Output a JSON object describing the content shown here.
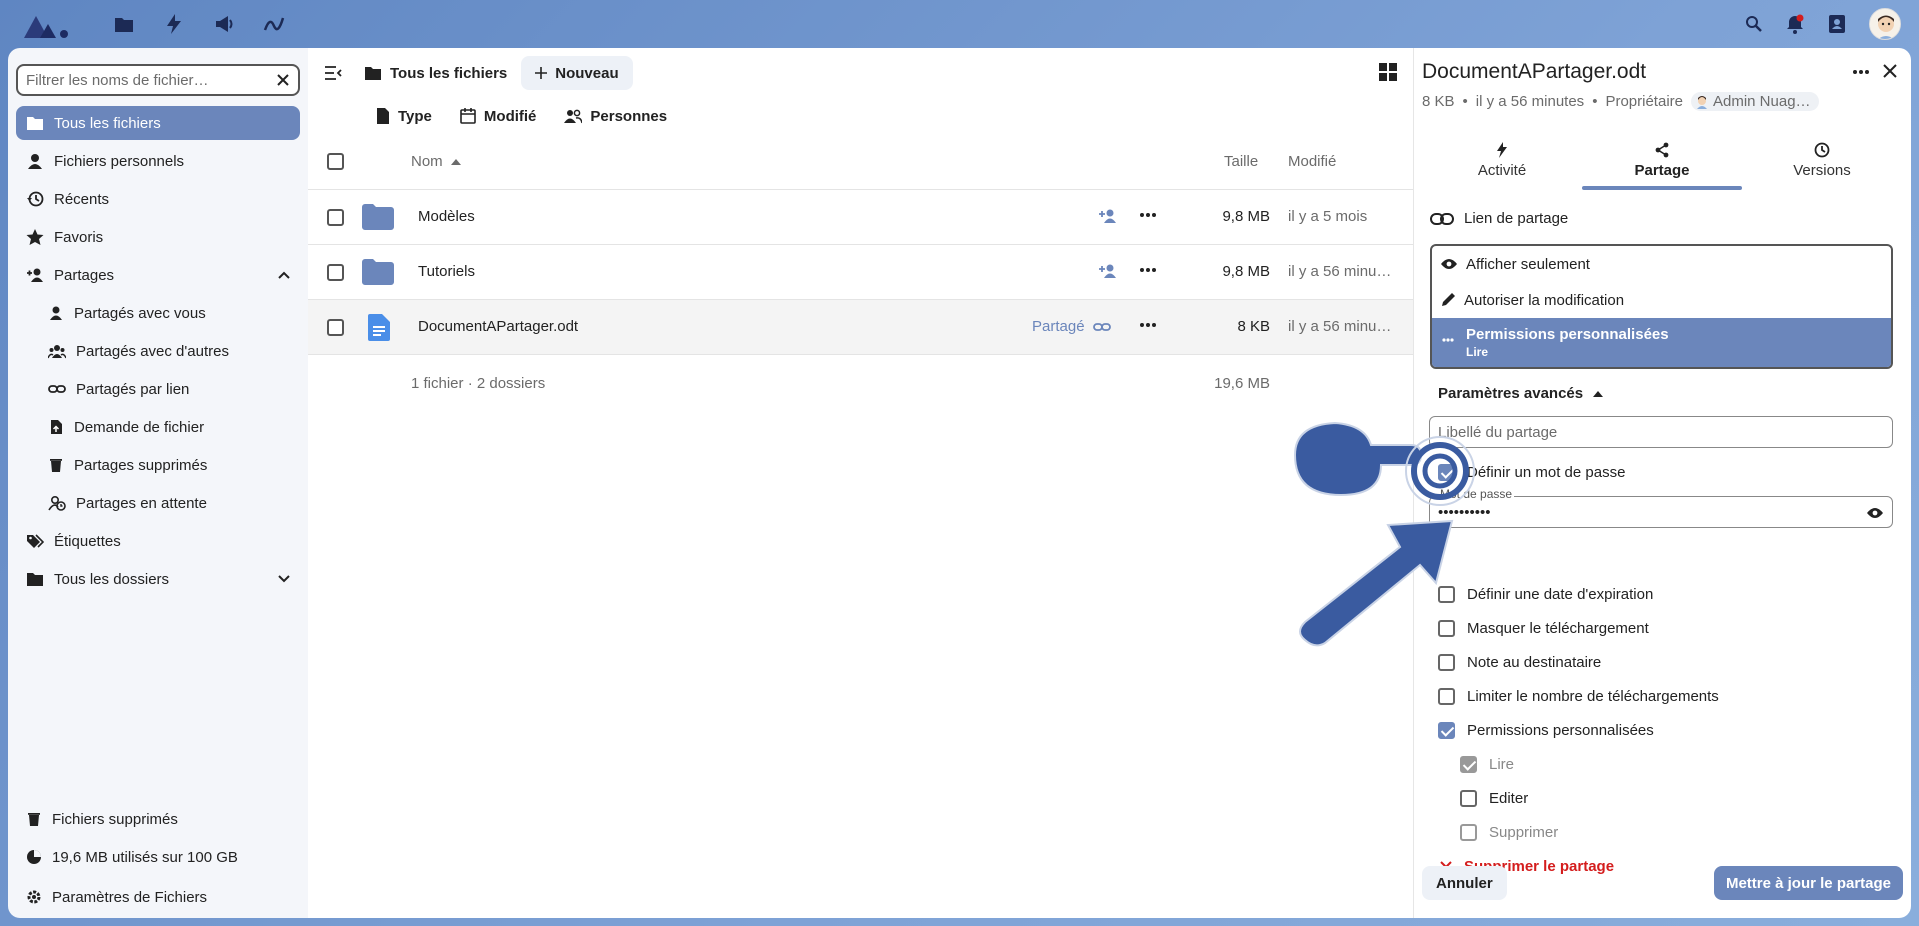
{
  "sidebar": {
    "filter_placeholder": "Filtrer les noms de fichier…",
    "items": [
      {
        "label": "Tous les fichiers"
      },
      {
        "label": "Fichiers personnels"
      },
      {
        "label": "Récents"
      },
      {
        "label": "Favoris"
      },
      {
        "label": "Partages"
      },
      {
        "label": "Partagés avec vous"
      },
      {
        "label": "Partagés avec d'autres"
      },
      {
        "label": "Partagés par lien"
      },
      {
        "label": "Demande de fichier"
      },
      {
        "label": "Partages supprimés"
      },
      {
        "label": "Partages en attente"
      },
      {
        "label": "Étiquettes"
      },
      {
        "label": "Tous les dossiers"
      }
    ],
    "deleted": "Fichiers supprimés",
    "quota": "19,6 MB utilisés sur 100 GB",
    "settings": "Paramètres de Fichiers"
  },
  "main": {
    "breadcrumb": "Tous les fichiers",
    "new_label": "Nouveau",
    "filters": [
      "Type",
      "Modifié",
      "Personnes"
    ],
    "columns": {
      "name": "Nom",
      "size": "Taille",
      "modified": "Modifié"
    },
    "rows": [
      {
        "name": "Modèles",
        "size": "9,8 MB",
        "modified": "il y a 5 mois"
      },
      {
        "name": "Tutoriels",
        "size": "9,8 MB",
        "modified": "il y a 56 minu…"
      },
      {
        "name": "DocumentAPartager.odt",
        "size": "8 KB",
        "modified": "il y a 56 minu…",
        "shared": "Partagé"
      }
    ],
    "summary": "1 fichier · 2 dossiers",
    "summary_size": "19,6 MB"
  },
  "panel": {
    "title": "DocumentAPartager.odt",
    "size": "8 KB",
    "time": "il y a 56 minutes",
    "role": "Propriétaire",
    "owner": "Admin Nuag…",
    "tabs": [
      "Activité",
      "Partage",
      "Versions"
    ],
    "link_label": "Lien de partage",
    "options": [
      "Afficher seulement",
      "Autoriser la modification"
    ],
    "selected_option": "Permissions personnalisées",
    "selected_sub": "Lire",
    "advanced": "Paramètres avancés",
    "label_placeholder": "Libellé du partage",
    "set_password": "Définir un mot de passe",
    "password_label": "Mot de passe",
    "password_value": "••••••••••",
    "checks": [
      "Définir une date d'expiration",
      "Masquer le téléchargement",
      "Note au destinataire",
      "Limiter le nombre de téléchargements",
      "Permissions personnalisées"
    ],
    "perms": [
      "Lire",
      "Editer",
      "Supprimer"
    ],
    "delete_share": "Supprimer le partage",
    "cancel": "Annuler",
    "update": "Mettre à jour le partage"
  },
  "colors": {
    "accent": "#6b86bb",
    "danger": "#d41d1d"
  }
}
